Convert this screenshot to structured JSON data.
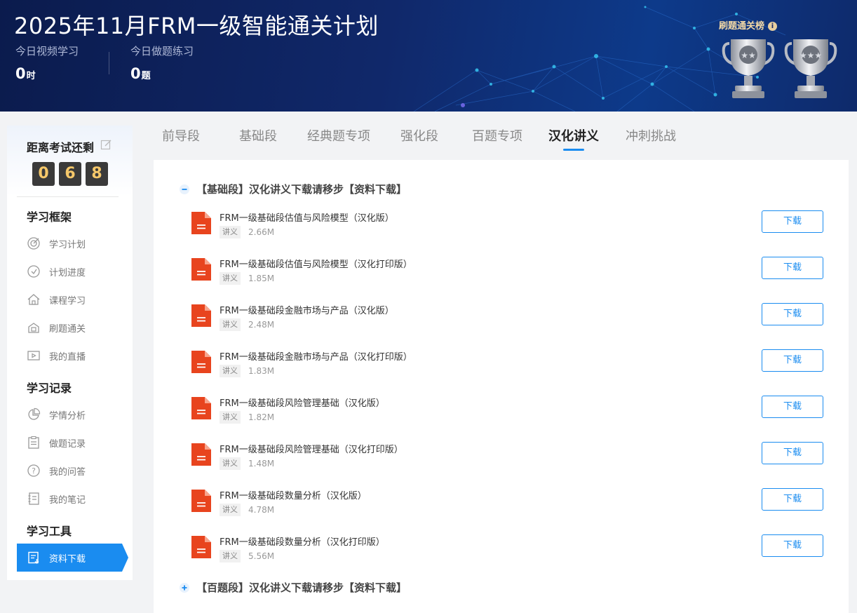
{
  "header": {
    "title": "2025年11月FRM一级智能通关计划",
    "video": {
      "label": "今日视频学习",
      "value": "0",
      "unit": "时"
    },
    "practice": {
      "label": "今日做题练习",
      "value": "0",
      "unit": "题"
    },
    "rank_title": "刷题通关榜",
    "rank_info": "i"
  },
  "sidebar": {
    "countdown_title": "距离考试还剩",
    "digits": [
      "0",
      "6",
      "8"
    ],
    "sections": [
      {
        "title": "学习框架",
        "items": [
          {
            "label": "学习计划",
            "icon": "target-icon"
          },
          {
            "label": "计划进度",
            "icon": "progress-icon"
          },
          {
            "label": "课程学习",
            "icon": "home-icon"
          },
          {
            "label": "刷题通关",
            "icon": "practice-icon"
          },
          {
            "label": "我的直播",
            "icon": "video-icon"
          }
        ]
      },
      {
        "title": "学习记录",
        "items": [
          {
            "label": "学情分析",
            "icon": "pie-chart-icon"
          },
          {
            "label": "做题记录",
            "icon": "clipboard-icon"
          },
          {
            "label": "我的问答",
            "icon": "question-icon"
          },
          {
            "label": "我的笔记",
            "icon": "notebook-icon"
          }
        ]
      },
      {
        "title": "学习工具",
        "items": [
          {
            "label": "资料下载",
            "icon": "download-doc-icon",
            "active": true
          }
        ]
      }
    ]
  },
  "tabs": [
    {
      "label": "前导段"
    },
    {
      "label": "基础段"
    },
    {
      "label": "经典题专项"
    },
    {
      "label": "强化段"
    },
    {
      "label": "百题专项"
    },
    {
      "label": "汉化讲义",
      "active": true
    },
    {
      "label": "冲刺挑战"
    }
  ],
  "groups": [
    {
      "title": "【基础段】汉化讲义下载请移步【资料下载】",
      "expanded": true,
      "files": [
        {
          "name": "FRM一级基础段估值与风险模型（汉化版）",
          "tag": "讲义",
          "size": "2.66M",
          "action": "下载"
        },
        {
          "name": "FRM一级基础段估值与风险模型（汉化打印版）",
          "tag": "讲义",
          "size": "1.85M",
          "action": "下载"
        },
        {
          "name": "FRM一级基础段金融市场与产品（汉化版）",
          "tag": "讲义",
          "size": "2.48M",
          "action": "下载"
        },
        {
          "name": "FRM一级基础段金融市场与产品（汉化打印版）",
          "tag": "讲义",
          "size": "1.83M",
          "action": "下载"
        },
        {
          "name": "FRM一级基础段风险管理基础（汉化版）",
          "tag": "讲义",
          "size": "1.82M",
          "action": "下载"
        },
        {
          "name": "FRM一级基础段风险管理基础（汉化打印版）",
          "tag": "讲义",
          "size": "1.48M",
          "action": "下载"
        },
        {
          "name": "FRM一级基础段数量分析（汉化版）",
          "tag": "讲义",
          "size": "4.78M",
          "action": "下载"
        },
        {
          "name": "FRM一级基础段数量分析（汉化打印版）",
          "tag": "讲义",
          "size": "5.56M",
          "action": "下载"
        }
      ]
    },
    {
      "title": "【百题段】汉化讲义下载请移步【资料下载】",
      "expanded": false,
      "files": []
    }
  ],
  "colors": {
    "accent": "#1a8cf0",
    "pdf_red": "#e8441e",
    "digit_bg": "#3a3a3a",
    "digit_fg": "#f6c86a"
  }
}
